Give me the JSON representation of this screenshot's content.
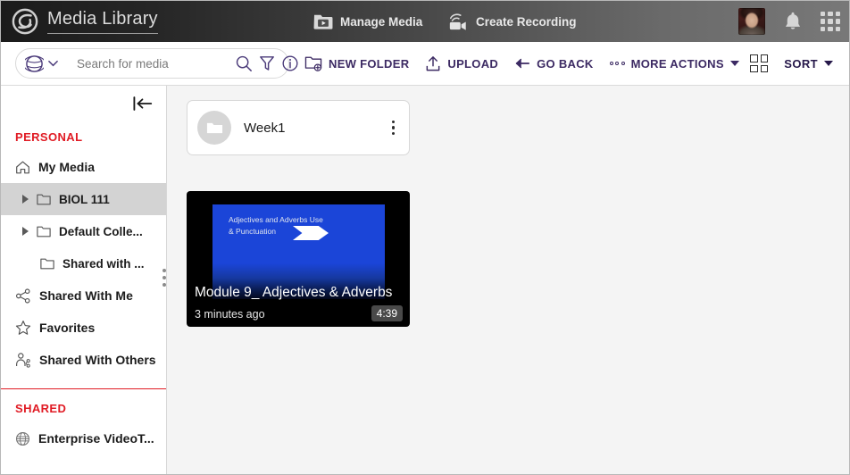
{
  "header": {
    "logo_icon": "swirl-logo-icon",
    "title": "Media Library",
    "manage_media": {
      "label": "Manage Media",
      "icon": "folder-play-icon"
    },
    "create_recording": {
      "label": "Create Recording",
      "icon": "webcam-record-icon"
    },
    "avatar_name": "user-avatar",
    "notifications_icon": "bell-icon",
    "apps_icon": "app-grid-icon"
  },
  "toolbar": {
    "scope_icon": "globe-icon",
    "scope_caret_icon": "chevron-down-icon",
    "search_placeholder": "Search for media",
    "search_value": "",
    "search_icon": "search-icon",
    "filter_icon": "filter-funnel-icon",
    "info_icon": "info-circle-icon",
    "buttons": [
      {
        "label": "NEW FOLDER",
        "icon": "new-folder-icon"
      },
      {
        "label": "UPLOAD",
        "icon": "upload-arrow-icon"
      },
      {
        "label": "GO BACK",
        "icon": "arrow-left-icon"
      },
      {
        "label": "MORE ACTIONS",
        "icon": "ellipsis-icon"
      }
    ],
    "view_toggle_icon": "grid-view-icon",
    "sort_label": "SORT",
    "sort_caret_icon": "caret-down-icon"
  },
  "sidebar": {
    "collapse_icon": "collapse-left-icon",
    "personal_label": "PERSONAL",
    "items": [
      {
        "label": "My Media",
        "icon": "home-icon",
        "level": 0,
        "active": false,
        "expandable": false
      },
      {
        "label": "BIOL 111",
        "icon": "folder-icon",
        "level": 1,
        "active": true,
        "expandable": true
      },
      {
        "label": "Default Colle...",
        "icon": "folder-icon",
        "level": 1,
        "active": false,
        "expandable": true
      },
      {
        "label": "Shared with ...",
        "icon": "folder-icon",
        "level": 2,
        "active": false,
        "expandable": false
      },
      {
        "label": "Shared With Me",
        "icon": "share-nodes-icon",
        "level": 0,
        "active": false,
        "expandable": false
      },
      {
        "label": "Favorites",
        "icon": "star-icon",
        "level": 0,
        "active": false,
        "expandable": false
      },
      {
        "label": "Shared With Others",
        "icon": "person-share-icon",
        "level": 0,
        "active": false,
        "expandable": false
      }
    ],
    "shared_label": "SHARED",
    "shared_items": [
      {
        "label": "Enterprise VideoT...",
        "icon": "globe-icon"
      }
    ],
    "resize_handle_icon": "drag-dots-icon"
  },
  "main": {
    "folder": {
      "name": "Week1",
      "icon": "folder-icon",
      "menu_icon": "kebab-menu-icon"
    },
    "video": {
      "title": "Module 9_ Adjectives & Adverbs",
      "uploaded": "3 minutes ago",
      "duration": "4:39",
      "thumbnail_text": "Adjectives and Adverbs Use\n& Punctuation",
      "thumbnail_bg": "#1b45d8",
      "thumbnail_arrow_icon": "arrow-chevron-shape"
    }
  },
  "colors": {
    "accent_purple": "#3c2a63",
    "section_red": "#e01b24",
    "active_row": "#d3d3d3",
    "canvas": "#f4f4f4"
  }
}
